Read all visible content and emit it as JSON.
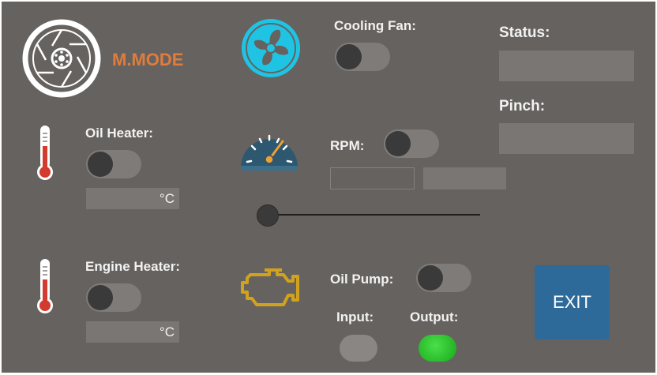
{
  "brand": {
    "text": "M.MODE",
    "color": "#e07c3c"
  },
  "cooling_fan": {
    "label": "Cooling Fan:",
    "on": false
  },
  "oil_heater": {
    "label": "Oil Heater:",
    "on": false,
    "unit": "°C",
    "value": ""
  },
  "engine_heater": {
    "label": "Engine Heater:",
    "on": false,
    "unit": "°C",
    "value": ""
  },
  "rpm": {
    "label": "RPM:",
    "on": false,
    "value1": "",
    "value2": "",
    "slider_fraction": 0.0
  },
  "oil_pump": {
    "label": "Oil Pump:",
    "on": false
  },
  "io": {
    "input_label": "Input:",
    "output_label": "Output:",
    "input_color": "#8a8684",
    "output_color": "#2bc22b"
  },
  "status": {
    "label": "Status:",
    "value": ""
  },
  "pinch": {
    "label": "Pinch:",
    "value": ""
  },
  "exit": {
    "label": "EXIT",
    "color": "#2d6a9a"
  },
  "icons": [
    "brake-disc-icon",
    "fan-icon",
    "thermometer-icon",
    "speedometer-icon",
    "engine-check-icon"
  ],
  "colors": {
    "background": "#66625f",
    "fan_accent": "#1fc4e4",
    "thermometer": "#d23b2e",
    "engine_icon": "#d1a21e",
    "gauge_body": "#2e5770",
    "gauge_needle": "#f0a030"
  }
}
